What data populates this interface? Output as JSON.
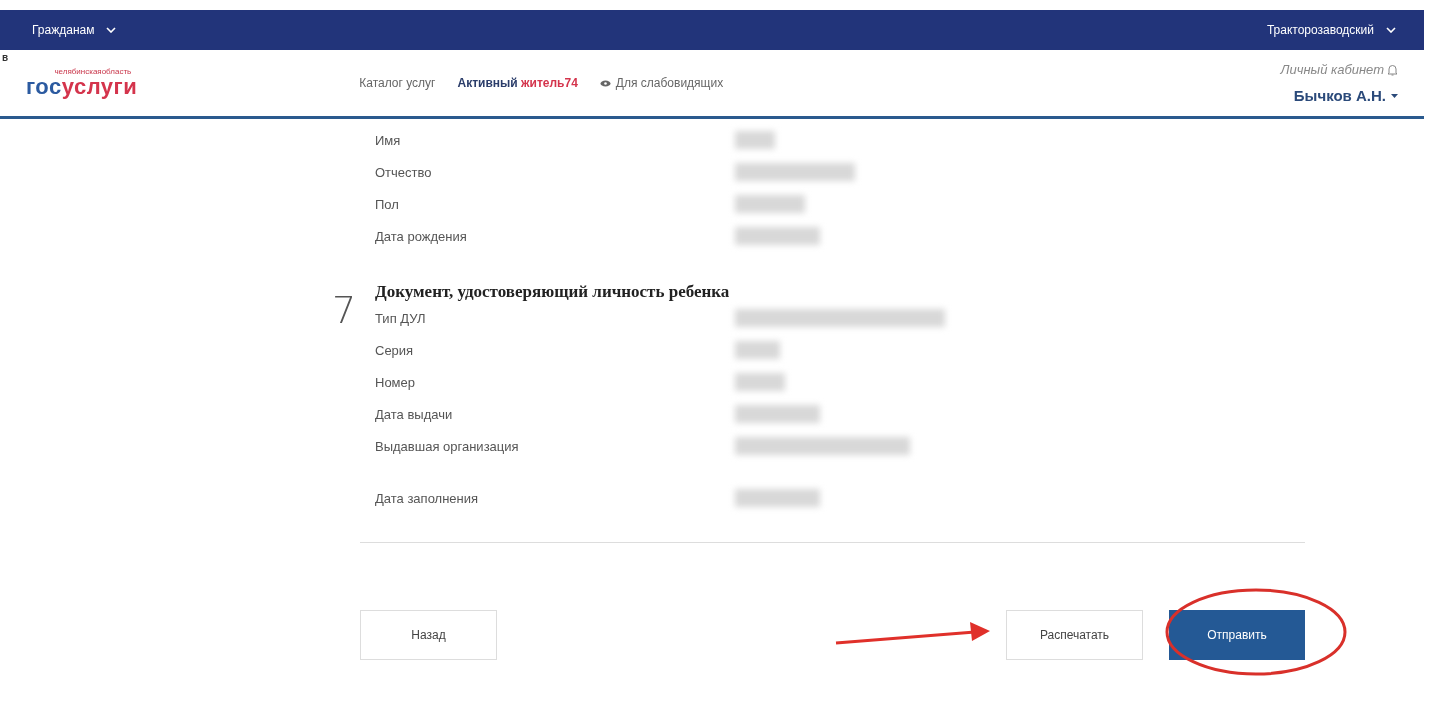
{
  "edge_mark": "в",
  "top_bar": {
    "left_menu": "Гражданам",
    "region_menu": "Тракторозаводский"
  },
  "header": {
    "logo": {
      "region": "челябинскаяобласть",
      "part_1": "гос",
      "part_2": "услуги"
    },
    "nav": [
      {
        "kind": "link",
        "label": "Каталог услуг"
      },
      {
        "kind": "brand",
        "label_1": "Активный",
        "label_2": "житель74"
      },
      {
        "kind": "eye",
        "label": "Для слабовидящих"
      }
    ],
    "cabinet": "Личный кабинет",
    "user": "Бычков А.Н."
  },
  "sections": [
    {
      "fields": [
        {
          "label": "Имя",
          "value_hidden": true
        },
        {
          "label": "Отчество",
          "value_hidden": true
        },
        {
          "label": "Пол",
          "value_hidden": true
        },
        {
          "label": "Дата рождения",
          "value_hidden": true
        }
      ]
    },
    {
      "number": "7",
      "title": "Документ, удостоверяющий личность ребенка",
      "fields": [
        {
          "label": "Тип ДУЛ",
          "value_hidden": true
        },
        {
          "label": "Серия",
          "value_hidden": true
        },
        {
          "label": "Номер",
          "value_hidden": true
        },
        {
          "label": "Дата выдачи",
          "value_hidden": true
        },
        {
          "label": "Выдавшая организация",
          "value_hidden": true
        }
      ]
    },
    {
      "fields": [
        {
          "label": "Дата заполнения",
          "value_hidden": true
        }
      ]
    }
  ],
  "buttons": [
    {
      "kind": "back",
      "label": "Назад"
    },
    {
      "kind": "secondary",
      "label": "Распечатать"
    },
    {
      "kind": "primary",
      "label": "Отправить",
      "highlighted": true
    }
  ],
  "annotation_arrow": true
}
